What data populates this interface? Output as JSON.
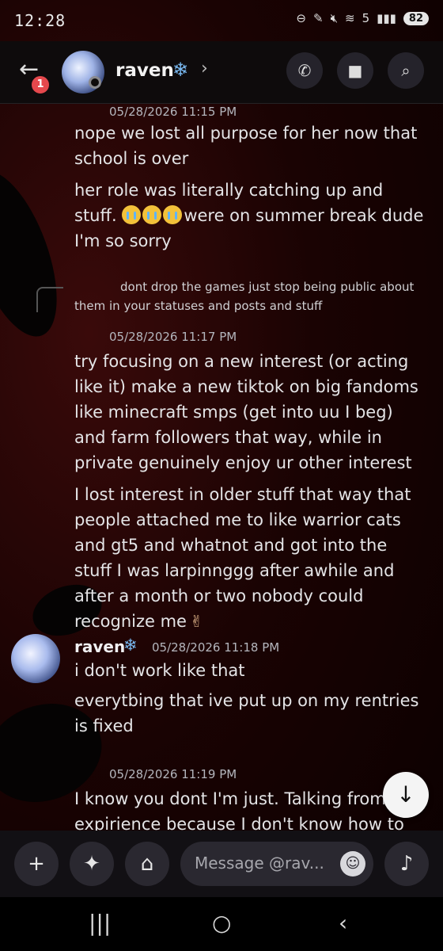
{
  "status_bar": {
    "time": "12:28",
    "signal_label": "5",
    "battery": "82"
  },
  "header": {
    "back_badge": "1",
    "contact_name": "raven",
    "name_emoji": "❄",
    "chevron": "›"
  },
  "messages": [
    {
      "timestamp": "05/28/2026 11:15 PM"
    },
    {
      "text": "nope we lost all purpose for her now that school is over"
    },
    {
      "text_before": "her role was literally catching up and stuff. ",
      "text_after": "were on summer break dude I'm so sorry"
    },
    {
      "reply_text": "dont drop the games just stop being public about them in your statuses and posts and stuff"
    },
    {
      "timestamp": "05/28/2026 11:17 PM"
    },
    {
      "text": "try focusing on a new interest (or acting like it) make a new tiktok on big fandoms like minecraft smps (get into uu I beg) and farm followers that way, while in private genuinely enjoy ur other interest"
    },
    {
      "text": "I lost interest in older stuff that way that people attached me to like warrior cats and gt5 and whatnot and got into the stuff I was larpinnggg after awhile and after a month or two nobody could recognize me"
    },
    {
      "author": "raven",
      "author_emoji": "❄",
      "timestamp": "05/28/2026 11:18 PM",
      "text": "i don't work like that"
    },
    {
      "text": "everytbing that ive put up on my rentries is fixed"
    },
    {
      "timestamp": "05/28/2026 11:19 PM"
    },
    {
      "text": "I know you dont I'm just. Talking from expirience because I don't know how to help"
    }
  ],
  "input": {
    "placeholder": "Message @rav..."
  },
  "icons": {
    "back": "arrow-left-icon",
    "call": "phone-icon",
    "video": "video-camera-icon",
    "search": "search-icon",
    "scroll_down": "arrow-down-icon",
    "add": "plus-icon",
    "apps": "apps-icon",
    "gift": "gift-icon",
    "emoji": "emoji-icon",
    "mic": "microphone-icon"
  },
  "colors": {
    "accent_red": "#e5484d",
    "snowflake": "#79b8f0",
    "background": "#1a0303"
  }
}
